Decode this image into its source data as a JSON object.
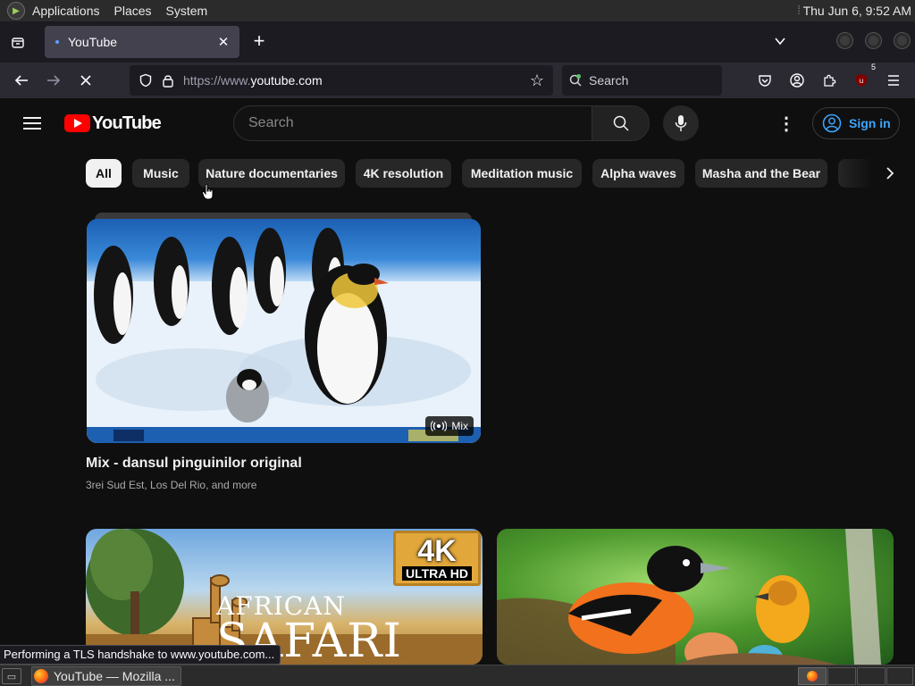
{
  "desktop": {
    "top_panel": {
      "menus": [
        "Applications",
        "Places",
        "System"
      ],
      "clock": "Thu Jun  6,  9:52 AM"
    },
    "taskbar": {
      "window_label": "YouTube — Mozilla ...",
      "workspaces": 4
    }
  },
  "browser": {
    "tab": {
      "title": "YouTube"
    },
    "url": {
      "scheme": "https://www.",
      "host": "youtube.com"
    },
    "search_placeholder": "Search",
    "extension_badge": "5",
    "status_text": "Performing a TLS handshake to www.youtube.com..."
  },
  "youtube": {
    "logo_text": "YouTube",
    "search_placeholder": "Search",
    "sign_in_label": "Sign in",
    "chips": [
      {
        "label": "All",
        "active": true
      },
      {
        "label": "Music"
      },
      {
        "label": "Nature documentaries"
      },
      {
        "label": "4K resolution"
      },
      {
        "label": "Meditation music"
      },
      {
        "label": "Alpha waves"
      },
      {
        "label": "Masha and the Bear"
      }
    ],
    "videos": [
      {
        "title": "Mix - dansul pinguinilor original",
        "meta": "3rei Sud Est, Los Del Rio, and more",
        "badge": "Mix"
      },
      {
        "thumb_text_top": "AFRICAN",
        "thumb_text_bottom": "SAFARI",
        "badge_big": "4K",
        "badge_small": "ULTRA HD"
      },
      {}
    ]
  },
  "colors": {
    "yt_background": "#0f0f0f",
    "yt_red": "#ff0000",
    "chip_bg": "#272727",
    "link_blue": "#3ea6ff",
    "firefox_toolbar": "#2b2a33",
    "firefox_tabstrip": "#1c1b22"
  }
}
